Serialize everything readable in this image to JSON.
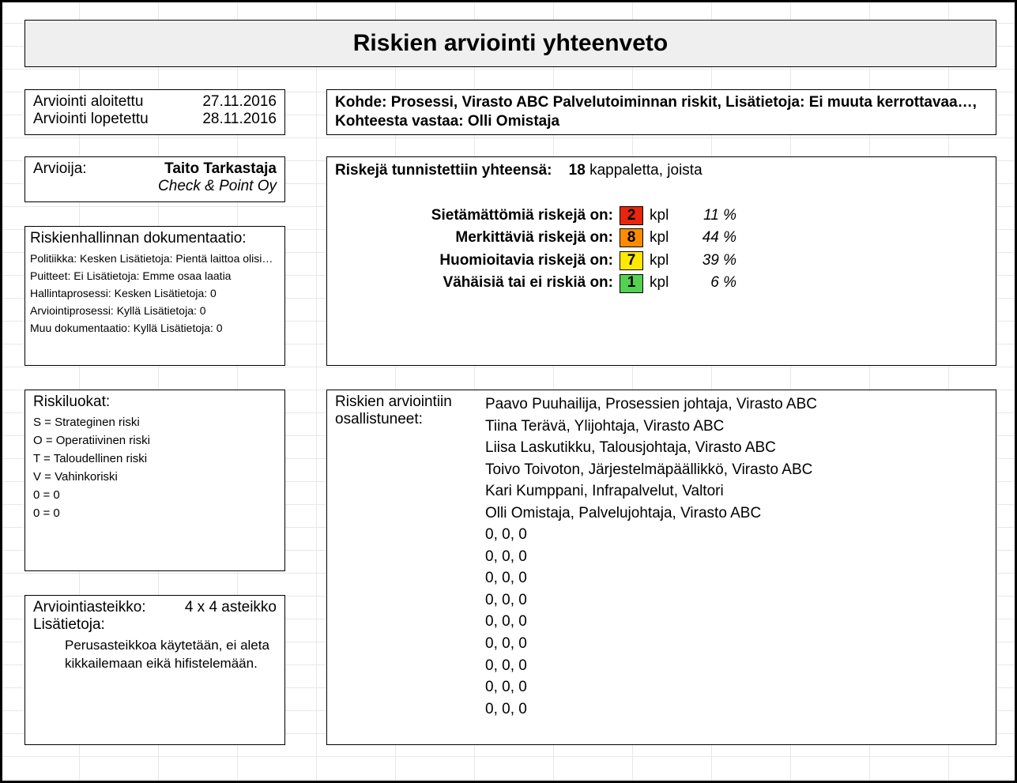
{
  "title": "Riskien arviointi yhteenveto",
  "dates": {
    "start_label": "Arviointi aloitettu",
    "start_value": "27.11.2016",
    "end_label": "Arviointi lopetettu",
    "end_value": "28.11.2016"
  },
  "target": "Kohde: Prosessi, Virasto ABC Palvelutoiminnan riskit, Lisätietoja: Ei muuta kerrottavaa…, Kohteesta vastaa: Olli Omistaja",
  "assessor": {
    "label": "Arvioija:",
    "name": "Taito Tarkastaja",
    "org": "Check & Point Oy"
  },
  "totals": {
    "head_a": "Riskejä tunnistettiin yhteensä:",
    "count": "18",
    "head_b": "kappaletta, joista",
    "rows": [
      {
        "label": "Sietämättömiä riskejä on:",
        "n": "2",
        "kpl": "kpl",
        "pct": "11 %",
        "cls": "c-red"
      },
      {
        "label": "Merkittäviä riskejä on:",
        "n": "8",
        "kpl": "kpl",
        "pct": "44 %",
        "cls": "c-orange"
      },
      {
        "label": "Huomioitavia riskejä on:",
        "n": "7",
        "kpl": "kpl",
        "pct": "39 %",
        "cls": "c-yellow"
      },
      {
        "label": "Vähäisiä tai ei riskiä on:",
        "n": "1",
        "kpl": "kpl",
        "pct": "6 %",
        "cls": "c-green"
      }
    ]
  },
  "docs": {
    "head": "Riskienhallinnan dokumentaatio:",
    "lines": [
      "Politiikka: Kesken Lisätietoja: Pientä laittoa olisi…",
      "Puitteet: Ei Lisätietoja: Emme osaa laatia",
      "Hallintaprosessi: Kesken Lisätietoja: 0",
      "Arviointiprosessi: Kyllä Lisätietoja: 0",
      "Muu dokumentaatio: Kyllä Lisätietoja: 0"
    ]
  },
  "cats": {
    "head": "Riskiluokat:",
    "lines": [
      "S = Strateginen riski",
      "O = Operatiivinen riski",
      "T = Taloudellinen riski",
      "V = Vahinkoriski",
      "0 = 0",
      "0 = 0"
    ]
  },
  "scale": {
    "label": "Arviointiasteikko:",
    "value": "4 x 4 asteikko",
    "extra_label": "Lisätietoja:",
    "note": "Perusasteikkoa käytetään, ei aleta kikkailemaan eikä hifistelemään."
  },
  "participants": {
    "label_a": "Riskien arviointiin",
    "label_b": "osallistuneet:",
    "people": [
      "Paavo Puuhailija, Prosessien johtaja, Virasto ABC",
      "Tiina Terävä, Ylijohtaja, Virasto ABC",
      "Liisa Laskutikku, Talousjohtaja, Virasto ABC",
      "Toivo Toivoton, Järjestelmäpäällikkö, Virasto ABC",
      "Kari Kumppani, Infrapalvelut, Valtori",
      "Olli Omistaja, Palvelujohtaja, Virasto ABC",
      "0, 0, 0",
      "0, 0, 0",
      "0, 0, 0",
      "0, 0, 0",
      "0, 0, 0",
      "0, 0, 0",
      "0, 0, 0",
      "0, 0, 0",
      "0, 0, 0"
    ]
  }
}
